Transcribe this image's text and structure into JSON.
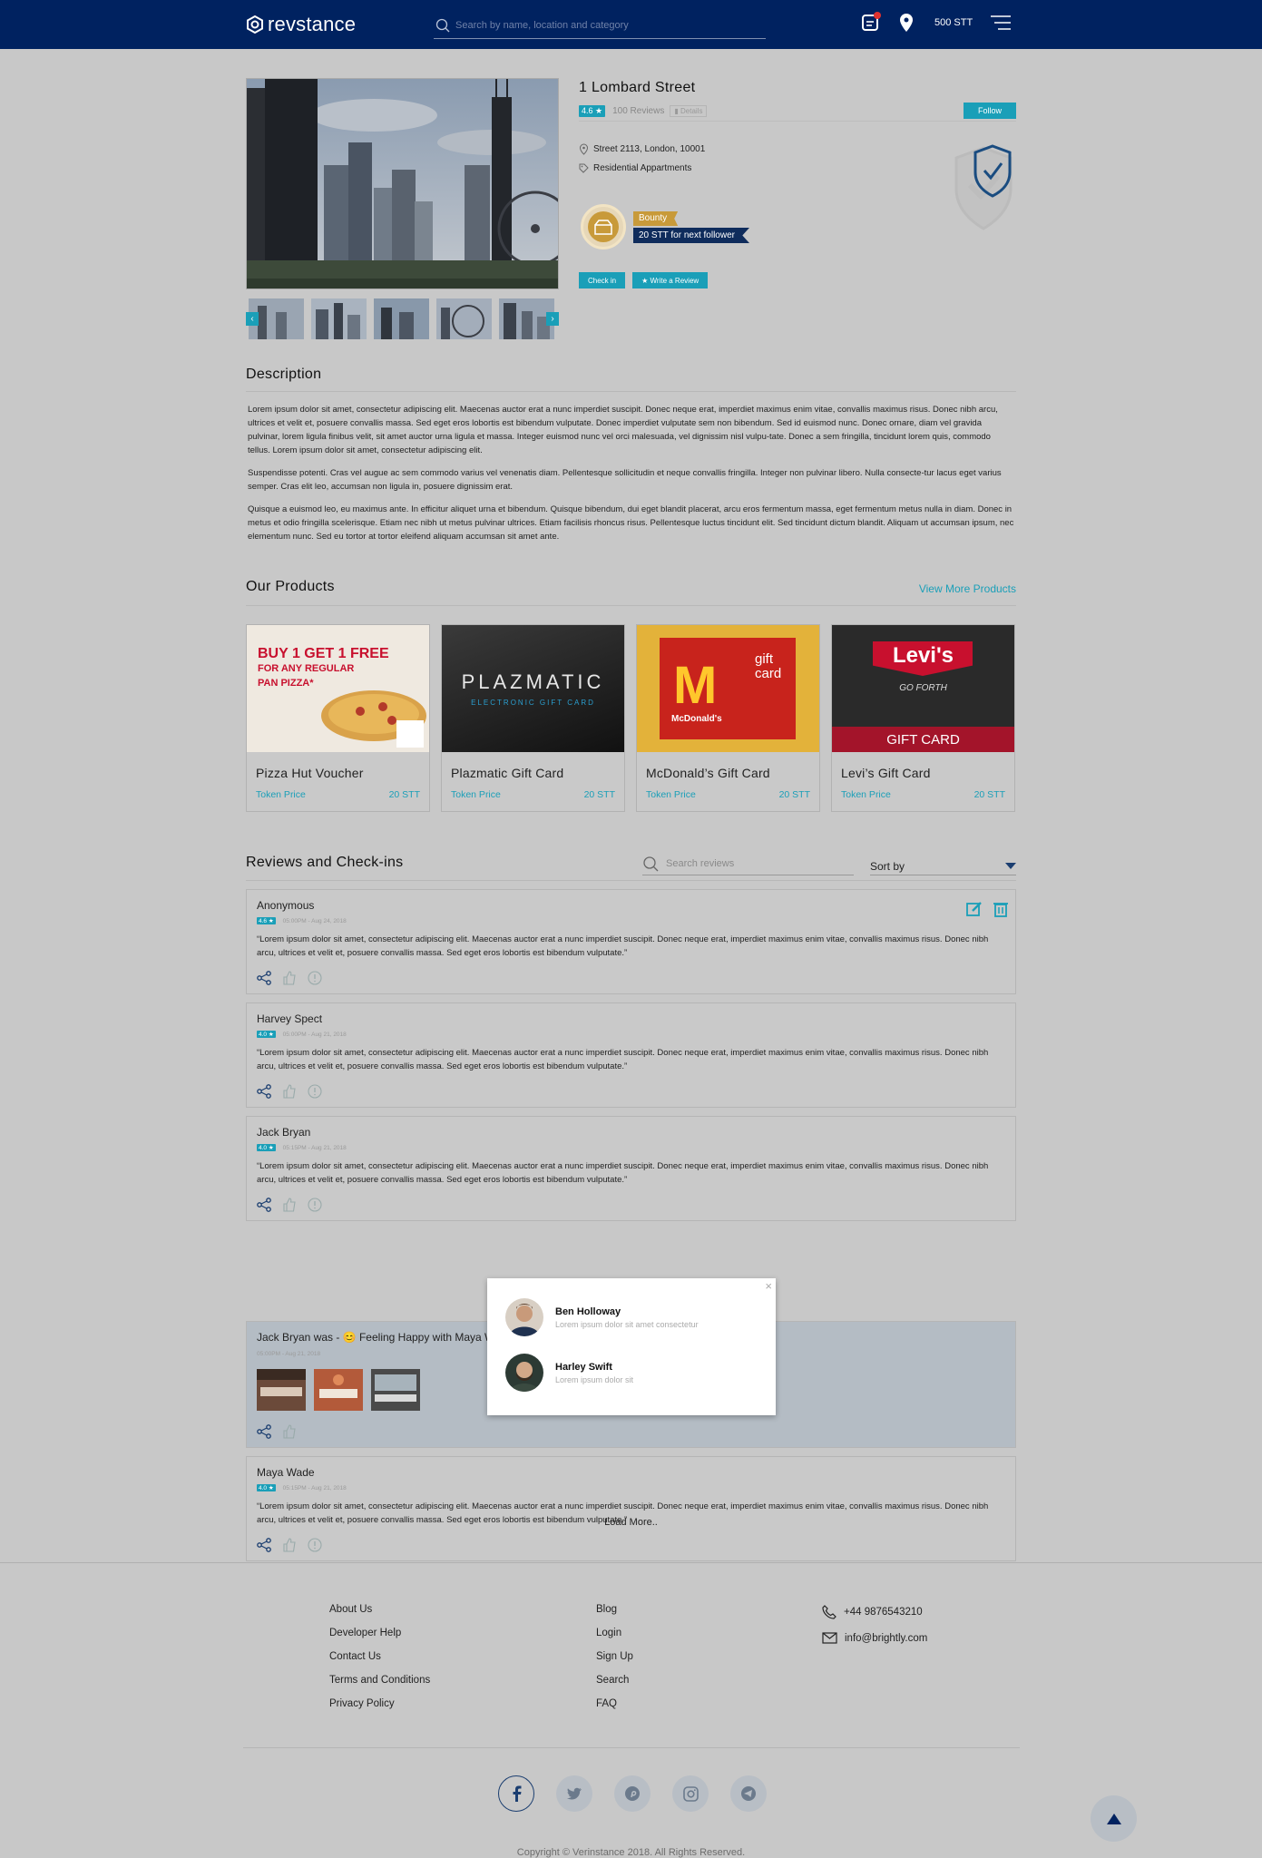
{
  "header": {
    "logo_text": "revstance",
    "search_placeholder": "Search by name, location and category",
    "balance": "500 STT"
  },
  "property": {
    "title": "1 Lombard Street",
    "rating": "4.6 ★",
    "reviews_count": "100 Reviews",
    "details_label": "Details",
    "follow_label": "Follow",
    "address": "Street 2113, London, 10001",
    "category": "Residential Appartments",
    "bounty_label": "Bounty",
    "bounty_text": "20 STT for next follower",
    "checkin_label": "Check in",
    "write_review_label": "★ Write a Review"
  },
  "description": {
    "title": "Description",
    "paragraphs": [
      "Lorem ipsum dolor sit amet, consectetur adipiscing elit. Maecenas auctor erat a nunc imperdiet suscipit. Donec neque erat, imperdiet maximus enim vitae, convallis maximus risus. Donec nibh arcu, ultrices et velit et, posuere convallis massa. Sed eget eros lobortis est bibendum vulputate. Donec imperdiet vulputate sem non bibendum. Sed id euismod nunc. Donec ornare, diam vel gravida pulvinar, lorem ligula finibus velit, sit amet auctor urna ligula et massa. Integer euismod nunc vel orci malesuada, vel dignissim nisl vulpu-tate. Donec a sem fringilla, tincidunt lorem quis, commodo tellus. Lorem ipsum dolor sit amet, consectetur adipiscing elit.",
      "Suspendisse potenti. Cras vel augue ac sem commodo varius vel venenatis diam. Pellentesque sollicitudin et neque convallis fringilla. Integer non pulvinar libero. Nulla consecte-tur lacus eget varius semper. Cras elit leo, accumsan non ligula in, posuere dignissim erat.",
      "Quisque a euismod leo, eu maximus ante. In efficitur aliquet urna et bibendum. Quisque bibendum, dui eget blandit placerat, arcu eros fermentum massa, eget fermentum metus nulla in diam. Donec in metus et odio fringilla scelerisque. Etiam nec nibh ut metus pulvinar ultrices. Etiam facilisis rhoncus risus. Pellentesque luctus tincidunt elit. Sed tincidunt dictum blandit. Aliquam ut accumsan ipsum, nec elementum nunc. Sed eu tortor at tortor eleifend aliquam accumsan sit amet ante."
    ]
  },
  "products": {
    "title": "Our Products",
    "view_more": "View More Products",
    "items": [
      {
        "name": "Pizza Hut Voucher",
        "price_label": "Token Price",
        "price": "20 STT",
        "img_lines": [
          "BUY 1 GET 1 FREE",
          "FOR ANY REGULAR",
          "PAN PIZZA*"
        ]
      },
      {
        "name": "Plazmatic Gift Card",
        "price_label": "Token Price",
        "price": "20 STT",
        "img_lines": [
          "PLAZMATIC",
          "ELECTRONIC GIFT CARD"
        ]
      },
      {
        "name": "McDonald’s Gift Card",
        "price_label": "Token Price",
        "price": "20 STT",
        "img_lines": [
          "gift",
          "card",
          "McDonald's"
        ]
      },
      {
        "name": "Levi’s Gift Card",
        "price_label": "Token Price",
        "price": "20 STT",
        "img_lines": [
          "Levi's",
          "GO FORTH",
          "GIFT CARD"
        ]
      }
    ]
  },
  "reviews": {
    "title": "Reviews and Check-ins",
    "search_placeholder": "Search reviews",
    "sort_label": "Sort by",
    "items": [
      {
        "name": "Anonymous",
        "rating": "4.6 ★",
        "time": "05:00PM - Aug 24, 2018",
        "text": "“Lorem ipsum dolor sit amet, consectetur adipiscing elit. Maecenas auctor erat a nunc imperdiet suscipit. Donec neque erat, imperdiet maximus enim vitae, convallis maximus risus. Donec nibh arcu, ultrices et velit et, posuere convallis massa. Sed eget eros lobortis est bibendum vulputate.”"
      },
      {
        "name": "Harvey Spect",
        "rating": "4.0 ★",
        "time": "05:00PM - Aug 21, 2018",
        "text": "“Lorem ipsum dolor sit amet, consectetur adipiscing elit. Maecenas auctor erat a nunc imperdiet suscipit. Donec neque erat, imperdiet maximus enim vitae, convallis maximus risus. Donec nibh arcu, ultrices et velit et, posuere convallis massa. Sed eget eros lobortis est bibendum vulputate.”"
      },
      {
        "name": "Jack Bryan",
        "rating": "4.0 ★",
        "time": "05:15PM - Aug 21, 2018",
        "text": "“Lorem ipsum dolor sit amet, consectetur adipiscing elit. Maecenas auctor erat a nunc imperdiet suscipit. Donec neque erat, imperdiet maximus enim vitae, convallis maximus risus. Donec nibh arcu, ultrices et velit et, posuere convallis massa. Sed eget eros lobortis est bibendum vulputate.”"
      },
      {
        "name": "Maya Wade",
        "rating": "4.0 ★",
        "time": "05:15PM - Aug 21, 2018",
        "text": "“Lorem ipsum dolor sit amet, consectetur adipiscing elit. Maecenas auctor erat a nunc imperdiet suscipit. Donec neque erat, imperdiet maximus enim vitae, convallis maximus risus. Donec nibh arcu, ultrices et velit et, posuere convallis massa. Sed eget eros lobortis est bibendum vulputate.”"
      }
    ],
    "checkin": {
      "text": "Jack Bryan was - 😊 Feeling Happy with Maya Wade and 2 others at 99 Street",
      "time": "05:00PM - Aug 21, 2018"
    },
    "popup": {
      "close": "×",
      "people": [
        {
          "name": "Ben Holloway",
          "sub": "Lorem ipsum dolor sit amet consectetur"
        },
        {
          "name": "Harley Swift",
          "sub": "Lorem ipsum dolor sit"
        }
      ]
    },
    "load_more": "Load More.."
  },
  "footer": {
    "col1": [
      "About Us",
      "Developer Help",
      "Contact Us",
      "Terms and Conditions",
      "Privacy Policy"
    ],
    "col2": [
      "Blog",
      "Login",
      "Sign Up",
      "Search",
      "FAQ"
    ],
    "phone": "+44 9876543210",
    "email": "info@brightly.com",
    "copyright": "Copyright © Verinstance 2018. All Rights Reserved."
  },
  "colors": {
    "navy": "#002260",
    "accent": "#1a9fb8",
    "gold": "#c89a3a",
    "background": "#c8c8c8"
  }
}
